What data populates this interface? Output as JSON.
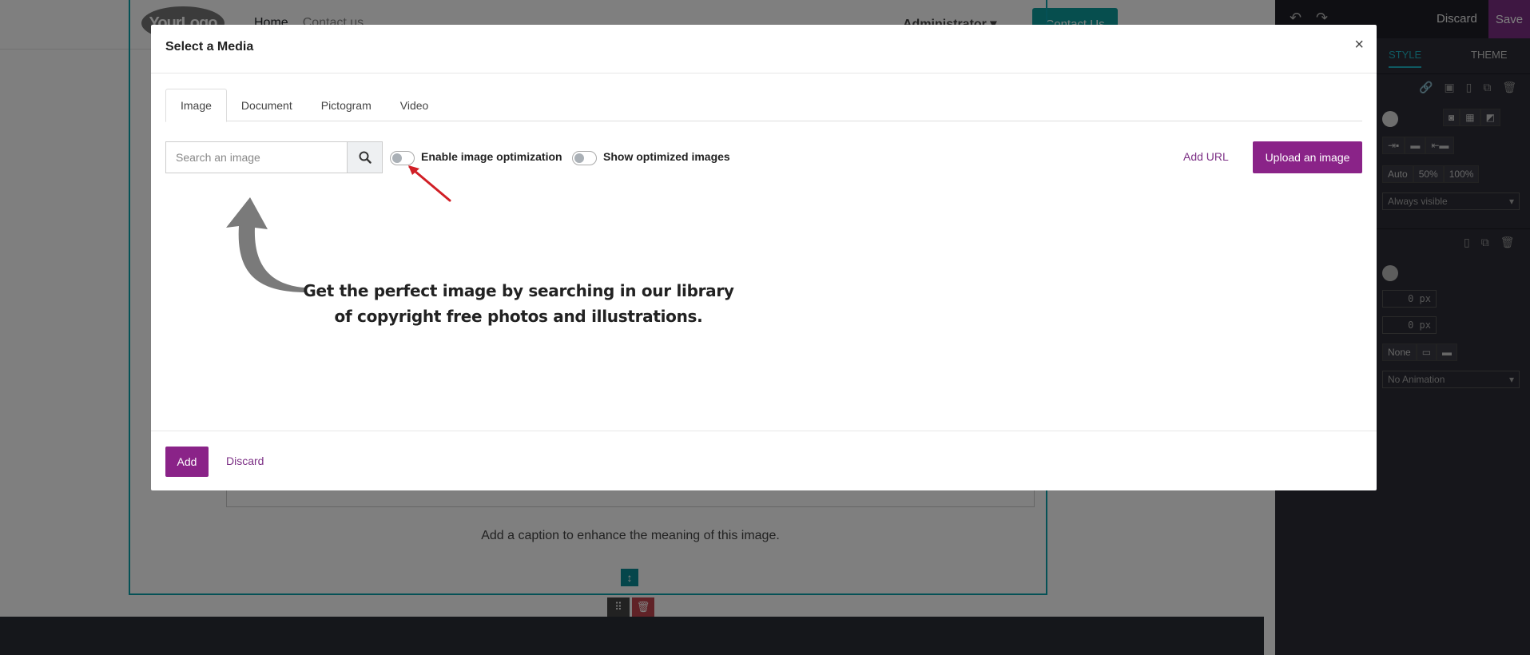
{
  "site": {
    "logo_text": "YourLogo",
    "nav": [
      "Home",
      "Contact us"
    ],
    "user_menu": "Administrator",
    "contact_button": "Contact Us",
    "caption": "Add a caption to enhance the meaning of this image."
  },
  "editor": {
    "discard": "Discard",
    "save": "Save",
    "tabs": [
      "STYLE",
      "THEME"
    ],
    "width_options": [
      "Auto",
      "50%",
      "100%"
    ],
    "visibility": "Always visible",
    "spacing_values": [
      "0 px",
      "0 px"
    ],
    "shadow_option": "None",
    "animation": "No Animation"
  },
  "modal": {
    "title": "Select a Media",
    "close": "×",
    "tabs": [
      {
        "label": "Image",
        "active": true
      },
      {
        "label": "Document",
        "active": false
      },
      {
        "label": "Pictogram",
        "active": false
      },
      {
        "label": "Video",
        "active": false
      }
    ],
    "search": {
      "placeholder": "Search an image",
      "value": ""
    },
    "toggles": [
      {
        "label": "Enable image optimization",
        "checked": false
      },
      {
        "label": "Show optimized images",
        "checked": false
      }
    ],
    "add_url": "Add URL",
    "upload": "Upload an image",
    "hint": "Get the perfect image by searching in our library of copyright free photos and illustrations.",
    "footer": {
      "add": "Add",
      "discard": "Discard"
    }
  },
  "colors": {
    "primary": "#8a2388",
    "link": "#7c2f85",
    "annotation_arrow": "#d11f26",
    "guide_arrow": "#7a7a7a"
  },
  "icons": {
    "search": "magnifier",
    "close": "times",
    "undo": "undo-arrow",
    "redo": "redo-arrow"
  }
}
